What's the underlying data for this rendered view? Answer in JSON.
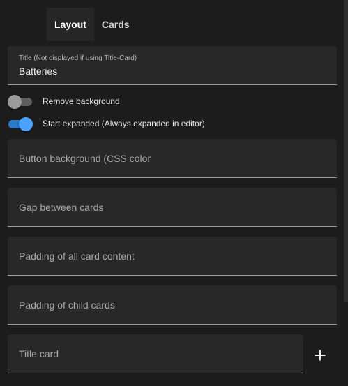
{
  "tabs": [
    {
      "label": "Layout",
      "active": true
    },
    {
      "label": "Cards",
      "active": false
    }
  ],
  "title_field": {
    "label": "Title (Not displayed if using Title-Card)",
    "value": "Batteries"
  },
  "toggles": [
    {
      "label": "Remove background",
      "checked": false
    },
    {
      "label": "Start expanded (Always expanded in editor)",
      "checked": true
    }
  ],
  "fields": {
    "button_background": {
      "label": "Button background (CSS color",
      "value": ""
    },
    "gap": {
      "label": "Gap between cards",
      "value": ""
    },
    "padding_content": {
      "label": "Padding of all card content",
      "value": ""
    },
    "padding_child": {
      "label": "Padding of child cards",
      "value": ""
    },
    "title_card": {
      "label": "Title card",
      "value": ""
    }
  },
  "add_button": {
    "icon": "plus-icon",
    "label": "+"
  },
  "colors": {
    "background": "#1c1c1c",
    "field_background": "#282828",
    "accent": "#4aa3ff",
    "tab_active_background": "#262626"
  }
}
